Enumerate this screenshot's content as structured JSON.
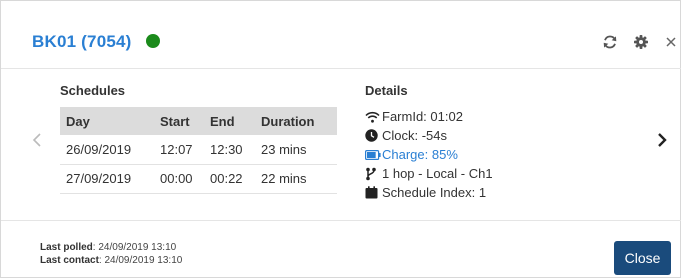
{
  "header": {
    "title": "BK01 (7054)",
    "status_color": "#1b8a1b",
    "icons": [
      "refresh-icon",
      "gear-icon",
      "close-icon"
    ]
  },
  "schedules": {
    "title": "Schedules",
    "columns": [
      "Day",
      "Start",
      "End",
      "Duration"
    ],
    "rows": [
      [
        "26/09/2019",
        "12:07",
        "12:30",
        "23 mins"
      ],
      [
        "27/09/2019",
        "00:00",
        "00:22",
        "22 mins"
      ]
    ]
  },
  "details": {
    "title": "Details",
    "farm_id": "FarmId: 01:02",
    "clock": "Clock: -54s",
    "charge": "Charge: 85%",
    "charge_level": 0.85,
    "charge_color": "#2a7fd3",
    "hops": "1 hop - Local - Ch1",
    "schedule_index": "Schedule Index: 1"
  },
  "footer": {
    "last_polled_label": "Last polled",
    "last_polled_value": ": 24/09/2019 13:10",
    "last_contact_label": "Last contact",
    "last_contact_value": ": 24/09/2019 13:10",
    "close_label": "Close",
    "close_color": "#1a4b7c"
  }
}
